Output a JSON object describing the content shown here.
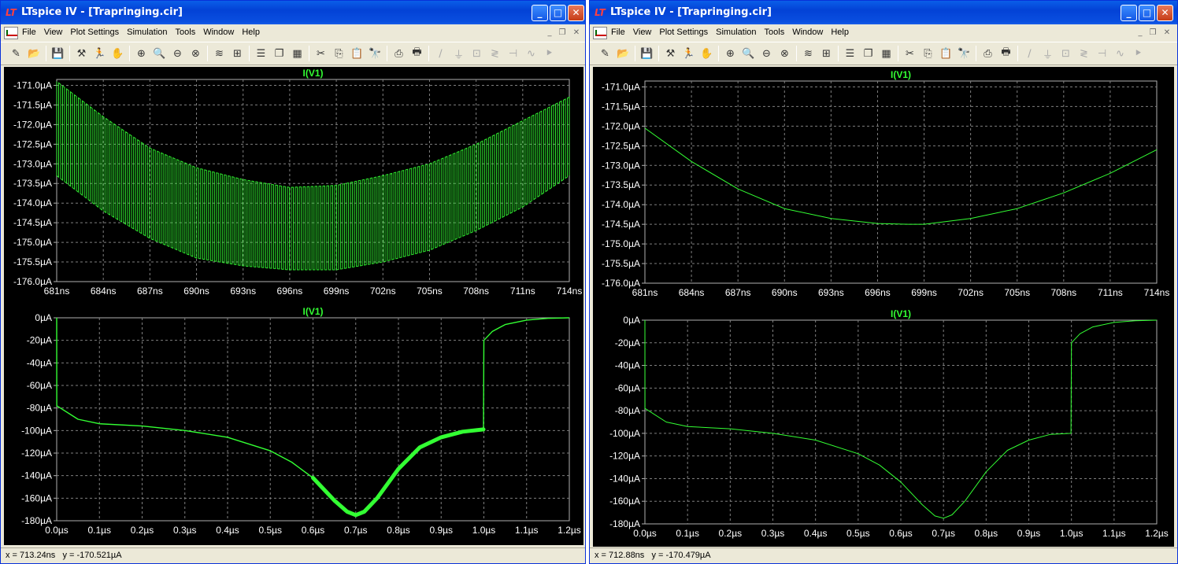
{
  "windows": [
    {
      "id": "left",
      "title": "LTspice IV - [Trapringing.cir]",
      "menu": [
        "File",
        "View",
        "Plot Settings",
        "Simulation",
        "Tools",
        "Window",
        "Help"
      ],
      "status": "x = 713.24ns   y = -170.521µA",
      "top_plot": {
        "label": "I(V1)",
        "x_ticks": [
          "681ns",
          "684ns",
          "687ns",
          "690ns",
          "693ns",
          "696ns",
          "699ns",
          "702ns",
          "705ns",
          "708ns",
          "711ns",
          "714ns"
        ],
        "y_ticks": [
          "-171.0µA",
          "-171.5µA",
          "-172.0µA",
          "-172.5µA",
          "-173.0µA",
          "-173.5µA",
          "-174.0µA",
          "-174.5µA",
          "-175.0µA",
          "-175.5µA",
          "-176.0µA"
        ]
      },
      "bottom_plot": {
        "label": "I(V1)",
        "x_ticks": [
          "0.0µs",
          "0.1µs",
          "0.2µs",
          "0.3µs",
          "0.4µs",
          "0.5µs",
          "0.6µs",
          "0.7µs",
          "0.8µs",
          "0.9µs",
          "1.0µs",
          "1.1µs",
          "1.2µs"
        ],
        "y_ticks": [
          "0µA",
          "-20µA",
          "-40µA",
          "-60µA",
          "-80µA",
          "-100µA",
          "-120µA",
          "-140µA",
          "-160µA",
          "-180µA"
        ]
      }
    },
    {
      "id": "right",
      "title": "LTspice IV - [Trapringing.cir]",
      "menu": [
        "File",
        "View",
        "Plot Settings",
        "Simulation",
        "Tools",
        "Window",
        "Help"
      ],
      "status": "x = 712.88ns   y = -170.479µA",
      "top_plot": {
        "label": "I(V1)",
        "x_ticks": [
          "681ns",
          "684ns",
          "687ns",
          "690ns",
          "693ns",
          "696ns",
          "699ns",
          "702ns",
          "705ns",
          "708ns",
          "711ns",
          "714ns"
        ],
        "y_ticks": [
          "-171.0µA",
          "-171.5µA",
          "-172.0µA",
          "-172.5µA",
          "-173.0µA",
          "-173.5µA",
          "-174.0µA",
          "-174.5µA",
          "-175.0µA",
          "-175.5µA",
          "-176.0µA"
        ]
      },
      "bottom_plot": {
        "label": "I(V1)",
        "x_ticks": [
          "0.0µs",
          "0.1µs",
          "0.2µs",
          "0.3µs",
          "0.4µs",
          "0.5µs",
          "0.6µs",
          "0.7µs",
          "0.8µs",
          "0.9µs",
          "1.0µs",
          "1.1µs",
          "1.2µs"
        ],
        "y_ticks": [
          "0µA",
          "-20µA",
          "-40µA",
          "-60µA",
          "-80µA",
          "-100µA",
          "-120µA",
          "-140µA",
          "-160µA",
          "-180µA"
        ]
      }
    }
  ],
  "colors": {
    "trace": "#33ff33",
    "label": "#33ff33",
    "axis_text": "#ffffff",
    "grid": "#7f7f7f",
    "background": "#000000"
  },
  "chart_data": [
    {
      "type": "line",
      "title": "I(V1)",
      "panel": "left-top",
      "xlabel": "",
      "ylabel": "",
      "xlim": [
        681,
        714
      ],
      "x_unit": "ns",
      "ylim": [
        -176.0,
        -170.85
      ],
      "y_unit": "µA",
      "grid": true,
      "series": [
        {
          "name": "I(V1)",
          "note_style": "oscillating envelope",
          "x": [
            681,
            684,
            687,
            690,
            693,
            696,
            699,
            702,
            705,
            708,
            711,
            714
          ],
          "envelope_upper": [
            -170.9,
            -171.8,
            -172.6,
            -173.1,
            -173.4,
            -173.6,
            -173.55,
            -173.3,
            -173.0,
            -172.5,
            -171.9,
            -171.3
          ],
          "envelope_lower": [
            -173.3,
            -174.2,
            -174.9,
            -175.4,
            -175.6,
            -175.7,
            -175.7,
            -175.5,
            -175.2,
            -174.7,
            -174.1,
            -173.3
          ]
        }
      ]
    },
    {
      "type": "line",
      "title": "I(V1)",
      "panel": "left-bottom",
      "xlabel": "",
      "ylabel": "",
      "xlim": [
        0,
        1.2
      ],
      "x_unit": "µs",
      "ylim": [
        -180,
        0
      ],
      "y_unit": "µA",
      "grid": true,
      "series": [
        {
          "name": "I(V1)",
          "x": [
            0,
            0.0001,
            0.05,
            0.1,
            0.2,
            0.3,
            0.4,
            0.5,
            0.55,
            0.6,
            0.65,
            0.68,
            0.7,
            0.72,
            0.75,
            0.8,
            0.85,
            0.9,
            0.95,
            0.999,
            1.0,
            1.02,
            1.05,
            1.1,
            1.15,
            1.2
          ],
          "y": [
            0,
            -78,
            -90,
            -94,
            -96,
            -100,
            -106,
            -118,
            -128,
            -142,
            -162,
            -172,
            -175,
            -172,
            -160,
            -134,
            -115,
            -106,
            -101,
            -99,
            -20,
            -12,
            -6,
            -2,
            -0.5,
            0
          ]
        }
      ]
    },
    {
      "type": "line",
      "title": "I(V1)",
      "panel": "right-top",
      "xlabel": "",
      "ylabel": "",
      "xlim": [
        681,
        714
      ],
      "x_unit": "ns",
      "ylim": [
        -176.0,
        -170.85
      ],
      "y_unit": "µA",
      "grid": true,
      "series": [
        {
          "name": "I(V1)",
          "x": [
            681,
            684,
            687,
            690,
            693,
            696,
            698,
            699,
            702,
            705,
            708,
            711,
            714
          ],
          "y": [
            -172.05,
            -172.9,
            -173.6,
            -174.1,
            -174.35,
            -174.48,
            -174.5,
            -174.5,
            -174.35,
            -174.1,
            -173.7,
            -173.2,
            -172.6
          ]
        }
      ]
    },
    {
      "type": "line",
      "title": "I(V1)",
      "panel": "right-bottom",
      "xlabel": "",
      "ylabel": "",
      "xlim": [
        0,
        1.2
      ],
      "x_unit": "µs",
      "ylim": [
        -180,
        0
      ],
      "y_unit": "µA",
      "grid": true,
      "series": [
        {
          "name": "I(V1)",
          "x": [
            0,
            0.0001,
            0.05,
            0.1,
            0.2,
            0.3,
            0.4,
            0.5,
            0.55,
            0.6,
            0.65,
            0.68,
            0.7,
            0.72,
            0.75,
            0.8,
            0.85,
            0.9,
            0.95,
            0.999,
            1.0,
            1.02,
            1.05,
            1.1,
            1.15,
            1.2
          ],
          "y": [
            0,
            -78,
            -90,
            -94,
            -96,
            -100,
            -106,
            -118,
            -128,
            -143,
            -163,
            -173,
            -175,
            -172,
            -160,
            -134,
            -115,
            -106,
            -101,
            -100,
            -20,
            -12,
            -6,
            -2,
            -0.5,
            0
          ]
        }
      ]
    }
  ]
}
